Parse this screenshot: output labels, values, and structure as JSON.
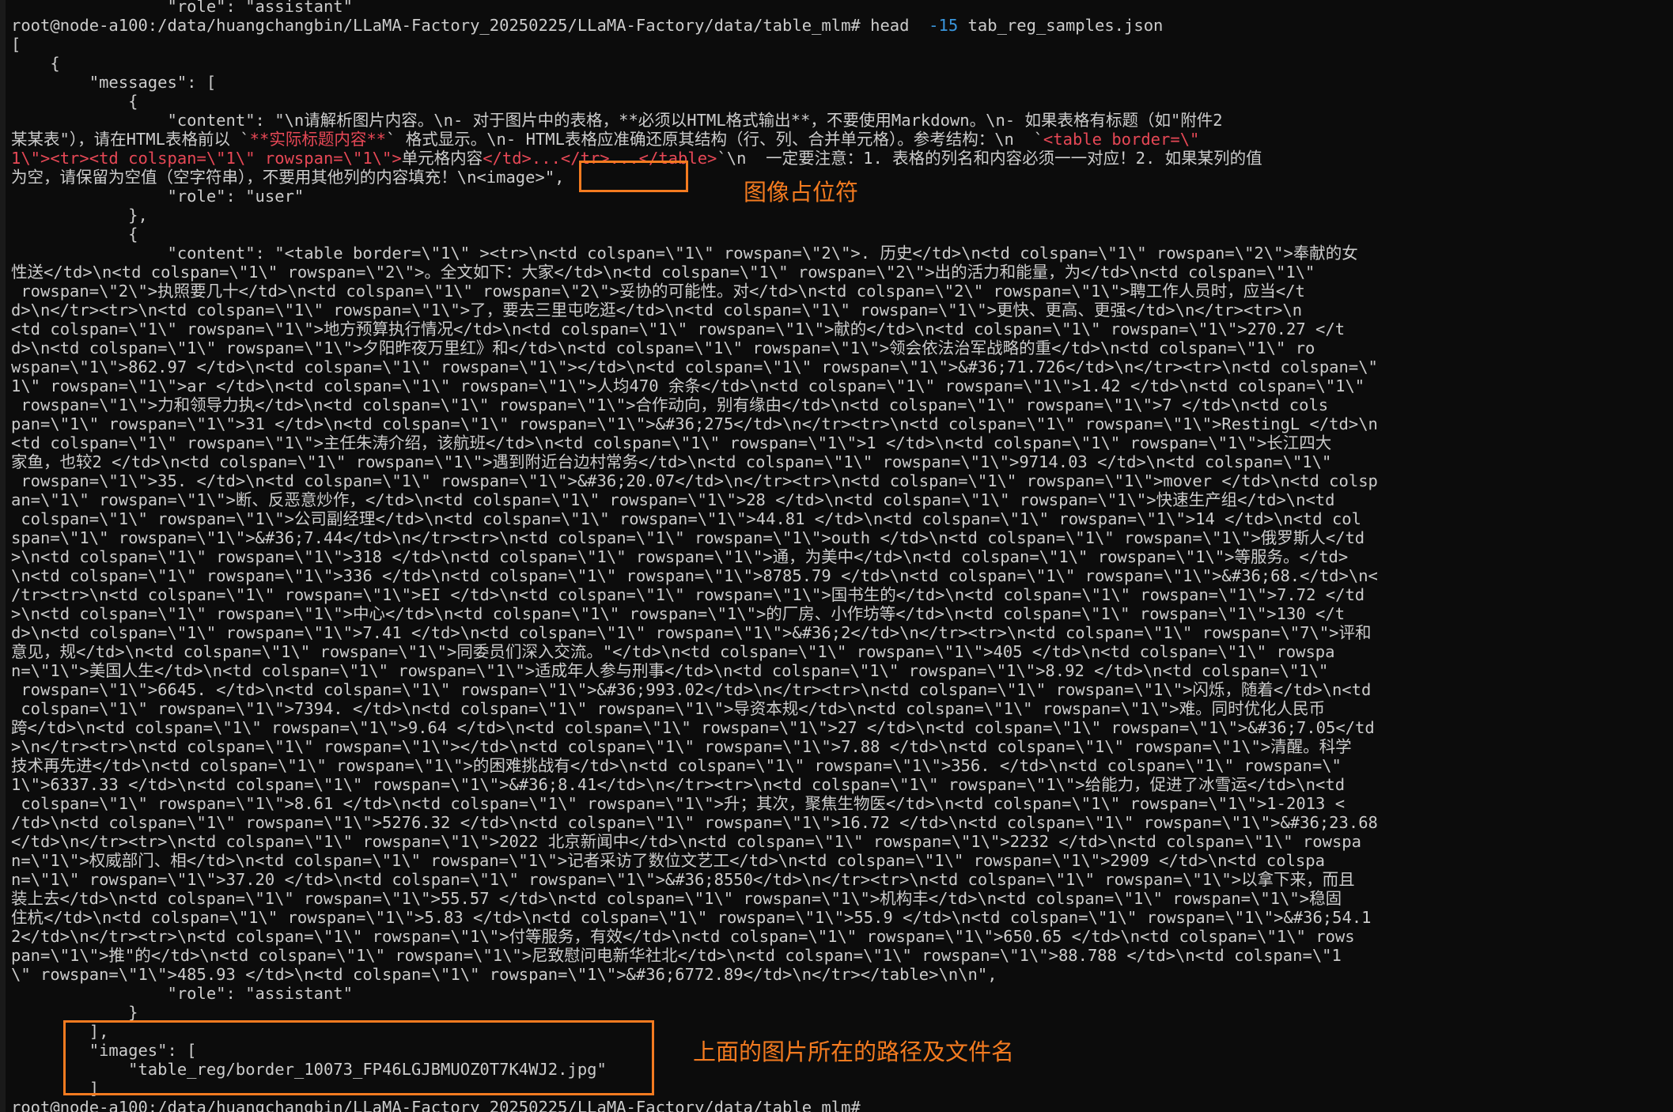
{
  "terminal": {
    "command_prompt": "root@node-a100:/data/huangchangbin/LLaMA-Factory_20250225/LLaMA-Factory/data/table_mlm# ",
    "command_name": "head  ",
    "command_flag": "-15",
    "command_file": " tab_reg_samples.json",
    "final_prompt": "root@node-a100:/data/huangchangbin/LLaMA-Factory_20250225/LLaMA-Factory/data/table_mlm# "
  },
  "lines": [
    {
      "text": "                \"role\": \"assistant\""
    },
    {
      "text": "[COMMAND]"
    },
    {
      "text": "["
    },
    {
      "text": "    {"
    },
    {
      "text": "        \"messages\": ["
    },
    {
      "text": "            {"
    },
    {
      "text": "                \"content\": \"\\n请解析图片内容。\\n- 对于图片中的表格，**必须以HTML格式输出**，不要使用Markdown。\\n- 如果表格有标题（如\"附件2"
    },
    {
      "text": "某某表\"），请在HTML表格前以 `",
      "red": "**实际标题内容**",
      "after": "` 格式显示。\\n- HTML表格应准确还原其结构（行、列、合并单元格）。参考结构：\\n  `",
      "red2": "<table border=\\\""
    },
    {
      "text": "",
      "red": "1\\\"><tr><td colspan=\\\"1\\\" rowspan=\\\"1\\\">",
      "after": "单元格内容",
      "red2": "</td>...</tr>...</table>",
      "after2": "`\\n  一定要注意：1. 表格的列名和内容必须一一对应！2. 如果某列的值"
    },
    {
      "text": "为空，请保留为空值（空字符串），不要用其他列的内容填充！\\n<image>\","
    },
    {
      "text": "                \"role\": \"user\""
    },
    {
      "text": "            },"
    },
    {
      "text": "            {"
    },
    {
      "text": "                \"content\": \"<table border=\\\"1\\\" ><tr>\\n<td colspan=\\\"1\\\" rowspan=\\\"2\\\">. 历史</td>\\n<td colspan=\\\"1\\\" rowspan=\\\"2\\\">奉献的女"
    },
    {
      "text": "性送</td>\\n<td colspan=\\\"1\\\" rowspan=\\\"2\\\">。全文如下：大家</td>\\n<td colspan=\\\"1\\\" rowspan=\\\"2\\\">出的活力和能量，为</td>\\n<td colspan=\\\"1\\\""
    },
    {
      "text": " rowspan=\\\"2\\\">执照要几十</td>\\n<td colspan=\\\"1\\\" rowspan=\\\"2\\\">妥协的可能性。对</td>\\n<td colspan=\\\"2\\\" rowspan=\\\"1\\\">聘工作人员时，应当</t"
    },
    {
      "text": "d>\\n</tr><tr>\\n<td colspan=\\\"1\\\" rowspan=\\\"1\\\">了，要去三里屯吃逛</td>\\n<td colspan=\\\"1\\\" rowspan=\\\"1\\\">更快、更高、更强</td>\\n</tr><tr>\\n"
    },
    {
      "text": "<td colspan=\\\"1\\\" rowspan=\\\"1\\\">地方预算执行情况</td>\\n<td colspan=\\\"1\\\" rowspan=\\\"1\\\">献的</td>\\n<td colspan=\\\"1\\\" rowspan=\\\"1\\\">270.27 </t"
    },
    {
      "text": "d>\\n<td colspan=\\\"1\\\" rowspan=\\\"1\\\">夕阳昨夜万里红》和</td>\\n<td colspan=\\\"1\\\" rowspan=\\\"1\\\">领会依法治军战略的重</td>\\n<td colspan=\\\"1\\\" ro"
    },
    {
      "text": "wspan=\\\"1\\\">862.97 </td>\\n<td colspan=\\\"1\\\" rowspan=\\\"1\\\"></td>\\n<td colspan=\\\"1\\\" rowspan=\\\"1\\\">&#36;71.726</td>\\n</tr><tr>\\n<td colspan=\\\""
    },
    {
      "text": "1\\\" rowspan=\\\"1\\\">ar </td>\\n<td colspan=\\\"1\\\" rowspan=\\\"1\\\">人均470 余条</td>\\n<td colspan=\\\"1\\\" rowspan=\\\"1\\\">1.42 </td>\\n<td colspan=\\\"1\\\""
    },
    {
      "text": " rowspan=\\\"1\\\">力和领导力执</td>\\n<td colspan=\\\"1\\\" rowspan=\\\"1\\\">合作动向，别有缘由</td>\\n<td colspan=\\\"1\\\" rowspan=\\\"1\\\">7 </td>\\n<td cols"
    },
    {
      "text": "pan=\\\"1\\\" rowspan=\\\"1\\\">31 </td>\\n<td colspan=\\\"1\\\" rowspan=\\\"1\\\">&#36;275</td>\\n</tr><tr>\\n<td colspan=\\\"1\\\" rowspan=\\\"1\\\">RestingL </td>\\n"
    },
    {
      "text": "<td colspan=\\\"1\\\" rowspan=\\\"1\\\">主任朱涛介绍，该航班</td>\\n<td colspan=\\\"1\\\" rowspan=\\\"1\\\">1 </td>\\n<td colspan=\\\"1\\\" rowspan=\\\"1\\\">长江四大"
    },
    {
      "text": "家鱼，也较2 </td>\\n<td colspan=\\\"1\\\" rowspan=\\\"1\\\">遇到附近台边村常务</td>\\n<td colspan=\\\"1\\\" rowspan=\\\"1\\\">9714.03 </td>\\n<td colspan=\\\"1\\\""
    },
    {
      "text": " rowspan=\\\"1\\\">35. </td>\\n<td colspan=\\\"1\\\" rowspan=\\\"1\\\">&#36;20.07</td>\\n</tr><tr>\\n<td colspan=\\\"1\\\" rowspan=\\\"1\\\">mover </td>\\n<td colsp"
    },
    {
      "text": "an=\\\"1\\\" rowspan=\\\"1\\\">断、反恶意炒作，</td>\\n<td colspan=\\\"1\\\" rowspan=\\\"1\\\">28 </td>\\n<td colspan=\\\"1\\\" rowspan=\\\"1\\\">快速生产组</td>\\n<td"
    },
    {
      "text": " colspan=\\\"1\\\" rowspan=\\\"1\\\">公司副经理</td>\\n<td colspan=\\\"1\\\" rowspan=\\\"1\\\">44.81 </td>\\n<td colspan=\\\"1\\\" rowspan=\\\"1\\\">14 </td>\\n<td col"
    },
    {
      "text": "span=\\\"1\\\" rowspan=\\\"1\\\">&#36;7.44</td>\\n</tr><tr>\\n<td colspan=\\\"1\\\" rowspan=\\\"1\\\">outh </td>\\n<td colspan=\\\"1\\\" rowspan=\\\"1\\\">俄罗斯人</td"
    },
    {
      "text": ">\\n<td colspan=\\\"1\\\" rowspan=\\\"1\\\">318 </td>\\n<td colspan=\\\"1\\\" rowspan=\\\"1\\\">通，为美中</td>\\n<td colspan=\\\"1\\\" rowspan=\\\"1\\\">等服务。</td>"
    },
    {
      "text": "\\n<td colspan=\\\"1\\\" rowspan=\\\"1\\\">336 </td>\\n<td colspan=\\\"1\\\" rowspan=\\\"1\\\">8785.79 </td>\\n<td colspan=\\\"1\\\" rowspan=\\\"1\\\">&#36;68.</td>\\n<"
    },
    {
      "text": "/tr><tr>\\n<td colspan=\\\"1\\\" rowspan=\\\"1\\\">EI </td>\\n<td colspan=\\\"1\\\" rowspan=\\\"1\\\">国书生的</td>\\n<td colspan=\\\"1\\\" rowspan=\\\"1\\\">7.72 </td"
    },
    {
      "text": ">\\n<td colspan=\\\"1\\\" rowspan=\\\"1\\\">中心</td>\\n<td colspan=\\\"1\\\" rowspan=\\\"1\\\">的厂房、小作坊等</td>\\n<td colspan=\\\"1\\\" rowspan=\\\"1\\\">130 </t"
    },
    {
      "text": "d>\\n<td colspan=\\\"1\\\" rowspan=\\\"1\\\">7.41 </td>\\n<td colspan=\\\"1\\\" rowspan=\\\"1\\\">&#36;2</td>\\n</tr><tr>\\n<td colspan=\\\"1\\\" rowspan=\\\"7\\\">评和"
    },
    {
      "text": "意见，规</td>\\n<td colspan=\\\"1\\\" rowspan=\\\"1\\\">同委员们深入交流。\"</td>\\n<td colspan=\\\"1\\\" rowspan=\\\"1\\\">405 </td>\\n<td colspan=\\\"1\\\" rowspa"
    },
    {
      "text": "n=\\\"1\\\">美国人生</td>\\n<td colspan=\\\"1\\\" rowspan=\\\"1\\\">适成年人参与刑事</td>\\n<td colspan=\\\"1\\\" rowspan=\\\"1\\\">8.92 </td>\\n<td colspan=\\\"1\\\""
    },
    {
      "text": " rowspan=\\\"1\\\">6645. </td>\\n<td colspan=\\\"1\\\" rowspan=\\\"1\\\">&#36;993.02</td>\\n</tr><tr>\\n<td colspan=\\\"1\\\" rowspan=\\\"1\\\">闪烁，随着</td>\\n<td"
    },
    {
      "text": " colspan=\\\"1\\\" rowspan=\\\"1\\\">7394. </td>\\n<td colspan=\\\"1\\\" rowspan=\\\"1\\\">导资本规</td>\\n<td colspan=\\\"1\\\" rowspan=\\\"1\\\">难。同时优化人民币"
    },
    {
      "text": "跨</td>\\n<td colspan=\\\"1\\\" rowspan=\\\"1\\\">9.64 </td>\\n<td colspan=\\\"1\\\" rowspan=\\\"1\\\">27 </td>\\n<td colspan=\\\"1\\\" rowspan=\\\"1\\\">&#36;7.05</td"
    },
    {
      "text": ">\\n</tr><tr>\\n<td colspan=\\\"1\\\" rowspan=\\\"1\\\"></td>\\n<td colspan=\\\"1\\\" rowspan=\\\"1\\\">7.88 </td>\\n<td colspan=\\\"1\\\" rowspan=\\\"1\\\">清醒。科学"
    },
    {
      "text": "技术再先进</td>\\n<td colspan=\\\"1\\\" rowspan=\\\"1\\\">的困难挑战有</td>\\n<td colspan=\\\"1\\\" rowspan=\\\"1\\\">356. </td>\\n<td colspan=\\\"1\\\" rowspan=\\\""
    },
    {
      "text": "1\\\">6337.33 </td>\\n<td colspan=\\\"1\\\" rowspan=\\\"1\\\">&#36;8.41</td>\\n</tr><tr>\\n<td colspan=\\\"1\\\" rowspan=\\\"1\\\">给能力，促进了冰雪运</td>\\n<td"
    },
    {
      "text": " colspan=\\\"1\\\" rowspan=\\\"1\\\">8.61 </td>\\n<td colspan=\\\"1\\\" rowspan=\\\"1\\\">升；其次，聚焦生物医</td>\\n<td colspan=\\\"1\\\" rowspan=\\\"1\\\">1-2013 <"
    },
    {
      "text": "/td>\\n<td colspan=\\\"1\\\" rowspan=\\\"1\\\">5276.32 </td>\\n<td colspan=\\\"1\\\" rowspan=\\\"1\\\">16.72 </td>\\n<td colspan=\\\"1\\\" rowspan=\\\"1\\\">&#36;23.68"
    },
    {
      "text": "</td>\\n</tr><tr>\\n<td colspan=\\\"1\\\" rowspan=\\\"1\\\">2022 北京新闻中</td>\\n<td colspan=\\\"1\\\" rowspan=\\\"1\\\">2232 </td>\\n<td colspan=\\\"1\\\" rowspa"
    },
    {
      "text": "n=\\\"1\\\">权威部门、相</td>\\n<td colspan=\\\"1\\\" rowspan=\\\"1\\\">记者采访了数位文艺工</td>\\n<td colspan=\\\"1\\\" rowspan=\\\"1\\\">2909 </td>\\n<td colspa"
    },
    {
      "text": "n=\\\"1\\\" rowspan=\\\"1\\\">37.20 </td>\\n<td colspan=\\\"1\\\" rowspan=\\\"1\\\">&#36;8550</td>\\n</tr><tr>\\n<td colspan=\\\"1\\\" rowspan=\\\"1\\\">以拿下来，而且"
    },
    {
      "text": "装上去</td>\\n<td colspan=\\\"1\\\" rowspan=\\\"1\\\">55.57 </td>\\n<td colspan=\\\"1\\\" rowspan=\\\"1\\\">机构丰</td>\\n<td colspan=\\\"1\\\" rowspan=\\\"1\\\">稳固"
    },
    {
      "text": "住杭</td>\\n<td colspan=\\\"1\\\" rowspan=\\\"1\\\">5.83 </td>\\n<td colspan=\\\"1\\\" rowspan=\\\"1\\\">55.9 </td>\\n<td colspan=\\\"1\\\" rowspan=\\\"1\\\">&#36;54.1"
    },
    {
      "text": "2</td>\\n</tr><tr>\\n<td colspan=\\\"1\\\" rowspan=\\\"1\\\">付等服务，有效</td>\\n<td colspan=\\\"1\\\" rowspan=\\\"1\\\">650.65 </td>\\n<td colspan=\\\"1\\\" rows"
    },
    {
      "text": "pan=\\\"1\\\">推\"的</td>\\n<td colspan=\\\"1\\\" rowspan=\\\"1\\\">尼致慰问电新华社北</td>\\n<td colspan=\\\"1\\\" rowspan=\\\"1\\\">88.788 </td>\\n<td colspan=\\\"1"
    },
    {
      "text": "\\\" rowspan=\\\"1\\\">485.93 </td>\\n<td colspan=\\\"1\\\" rowspan=\\\"1\\\">&#36;6772.89</td>\\n</tr></table>\\n\\n\","
    },
    {
      "text": "                \"role\": \"assistant\""
    },
    {
      "text": "            }"
    },
    {
      "text": "        ],"
    },
    {
      "text": "        \"images\": ["
    },
    {
      "text": "            \"table_reg/border_10073_FP46LGJBMUOZ0T7K4WJ2.jpg\""
    },
    {
      "text": "        ]"
    },
    {
      "text": "[PROMPT]"
    }
  ],
  "annotations": {
    "image_placeholder": "图像占位符",
    "image_path": "上面的图片所在的路径及文件名"
  },
  "colors": {
    "background": "#0c0c0c",
    "text": "#cccccc",
    "flag": "#3a96dd",
    "code_highlight": "#e74856",
    "annotation": "#f47b20"
  }
}
